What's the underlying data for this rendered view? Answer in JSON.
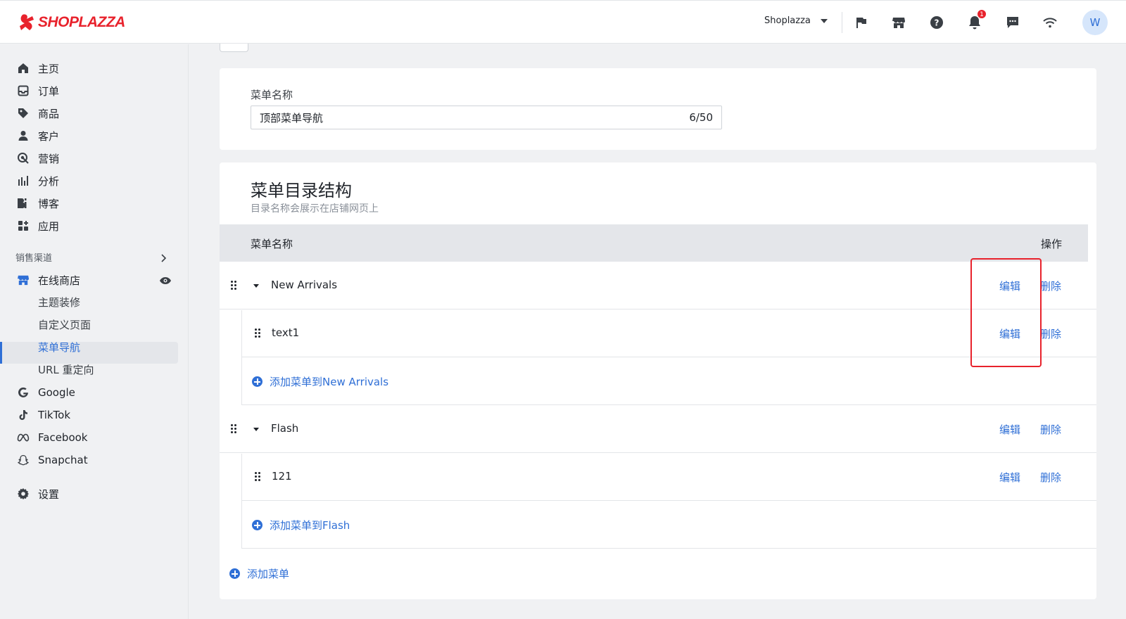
{
  "topbar": {
    "brand": "SHOPLAZZA",
    "store_name": "Shoplazza",
    "notification_count": "1",
    "avatar_letter": "W",
    "icons": [
      "flag-icon",
      "store-icon",
      "help-icon",
      "bell-icon",
      "message-icon",
      "wifi-icon"
    ]
  },
  "sidebar": {
    "items": [
      {
        "label": "主页",
        "icon": "home-icon"
      },
      {
        "label": "订单",
        "icon": "inbox-icon"
      },
      {
        "label": "商品",
        "icon": "tag-icon"
      },
      {
        "label": "客户",
        "icon": "person-icon"
      },
      {
        "label": "营销",
        "icon": "target-icon"
      },
      {
        "label": "分析",
        "icon": "bar-chart-icon"
      },
      {
        "label": "博客",
        "icon": "blog-icon"
      },
      {
        "label": "应用",
        "icon": "apps-icon"
      }
    ],
    "channels_label": "销售渠道",
    "online_store": "在线商店",
    "sub_items": [
      "主题装修",
      "自定义页面",
      "菜单导航",
      "URL 重定向"
    ],
    "channels": [
      {
        "label": "Google",
        "icon": "google-icon"
      },
      {
        "label": "TikTok",
        "icon": "tiktok-icon"
      },
      {
        "label": "Facebook",
        "icon": "meta-icon"
      },
      {
        "label": "Snapchat",
        "icon": "snapchat-icon"
      }
    ],
    "settings": "设置"
  },
  "menu_name_card": {
    "label": "菜单名称",
    "value": "顶部菜单导航",
    "counter": "6/50"
  },
  "structure_card": {
    "title": "菜单目录结构",
    "subtitle": "目录名称会展示在店铺网页上",
    "col_name": "菜单名称",
    "col_action": "操作",
    "edit": "编辑",
    "delete": "删除",
    "rows": [
      {
        "name": "New Arrivals",
        "level": 1
      },
      {
        "name": "text1",
        "level": 2
      },
      {
        "add": "添加菜单到New Arrivals"
      },
      {
        "name": "Flash",
        "level": 1
      },
      {
        "name": "121",
        "level": 2
      },
      {
        "add": "添加菜单到Flash"
      }
    ],
    "add_menu": "添加菜单"
  }
}
